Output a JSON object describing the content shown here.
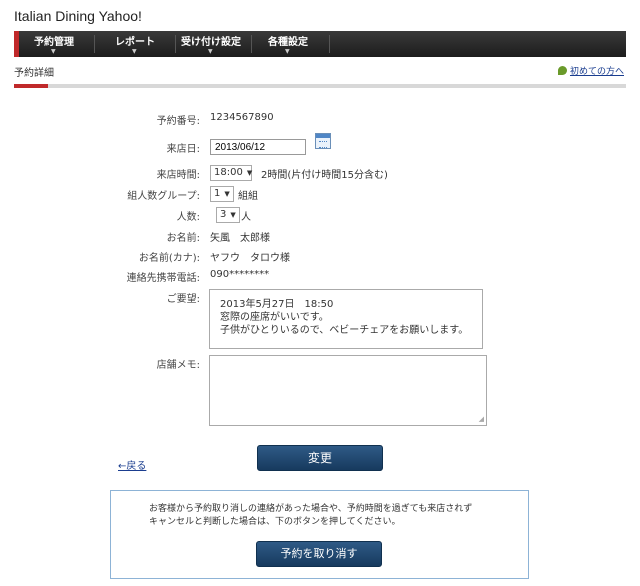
{
  "app": {
    "title": "Italian Dining Yahoo!"
  },
  "nav": {
    "items": [
      {
        "label": "予約管理"
      },
      {
        "label": "レポート"
      },
      {
        "label": "受け付け設定"
      },
      {
        "label": "各種設定"
      }
    ]
  },
  "page": {
    "title": "予約詳細",
    "help_link": "初めての方へ"
  },
  "form": {
    "reservation_number": {
      "label": "予約番号:",
      "value": "1234567890"
    },
    "visit_date": {
      "label": "来店日:",
      "value": "2013/06/12"
    },
    "visit_time": {
      "label": "来店時間:",
      "value": "18:00",
      "note": "2時間(片付け時間15分含む)"
    },
    "group_count": {
      "label": "組人数グループ:",
      "value": "1",
      "suffix": "組組"
    },
    "party_size": {
      "label": "人数:",
      "value": "3",
      "suffix": "人"
    },
    "name": {
      "label": "お名前:",
      "value": "矢風　太郎様"
    },
    "name_kana": {
      "label": "お名前(カナ):",
      "value": "ヤフウ　タロウ様"
    },
    "phone": {
      "label": "連絡先携帯電話:",
      "value": "090********"
    },
    "request": {
      "label": "ご要望:",
      "value": "2013年5月27日　18:50\n窓際の座席がいいです。\n子供がひとりいるので、ベビーチェアをお願いします。"
    },
    "store_memo": {
      "label": "店舗メモ:",
      "value": ""
    }
  },
  "actions": {
    "back_label": "←戻る",
    "change_label": "変更"
  },
  "notice": {
    "text": "お客様から予約取り消しの連絡があった場合や、予約時間を過ぎても来店されず\nキャンセルと判断した場合は、下のボタンを押してください。",
    "cancel_label": "予約を取り消す"
  },
  "colors": {
    "accent": "#c0292a",
    "button": "#1f4570",
    "link": "#1a3d8f"
  }
}
